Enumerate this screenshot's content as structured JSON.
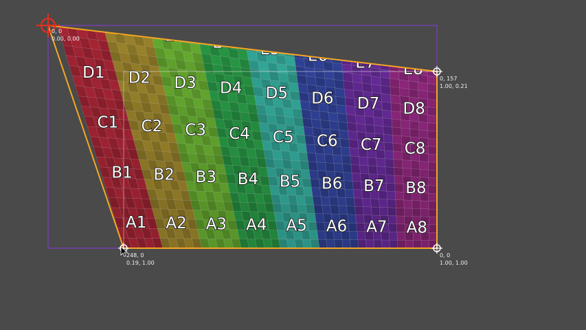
{
  "grid": {
    "rows": [
      "A",
      "B",
      "C",
      "D",
      "E"
    ],
    "columns": [
      "1",
      "2",
      "3",
      "4",
      "5",
      "6",
      "7",
      "8"
    ],
    "column_colors": [
      "#b7283a",
      "#a88f2e",
      "#6fbb33",
      "#2aa54a",
      "#36b7a6",
      "#3548a6",
      "#6e2ea5",
      "#9a2a86"
    ]
  },
  "corners": [
    {
      "id": "top-left",
      "line1": "0, 0",
      "line2": "0.00, 0.00"
    },
    {
      "id": "top-right",
      "line1": "0, 157",
      "line2": "1.00, 0.21"
    },
    {
      "id": "bottom-left",
      "line1": "248, 0",
      "line2": "0.19, 1.00"
    },
    {
      "id": "bottom-right",
      "line1": "0, 0",
      "line2": "1.00, 1.00"
    }
  ],
  "colors": {
    "background": "#4a4a4a",
    "outline": "#f5a623",
    "bounding_box": "#7b3fc4",
    "active_handle": "#e0301e",
    "handle": "#ffffff"
  },
  "cursor_icon": "arrow-cursor-icon",
  "handle_icon": "circle-crosshair-icon",
  "active_handle_icon": "target-crosshair-icon"
}
